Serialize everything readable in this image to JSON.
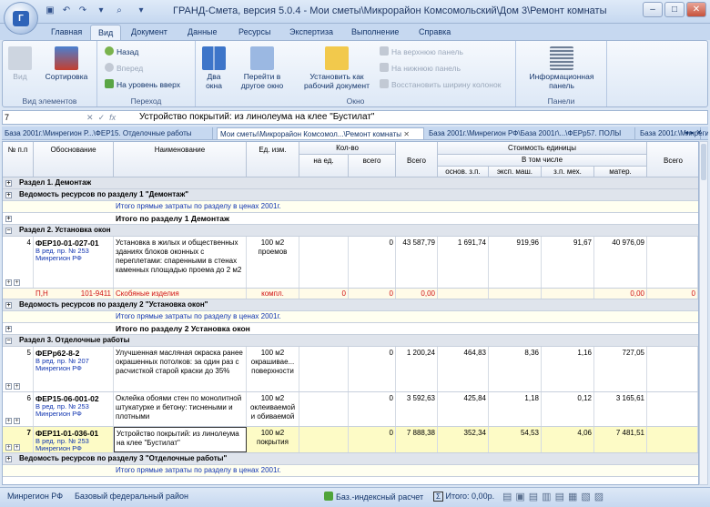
{
  "window": {
    "title": "ГРАНД-Смета, версия 5.0.4 - Мои сметы\\Микрорайон Комсомольский\\Дом 3\\Ремонт комнаты",
    "min": "–",
    "max": "□",
    "close": "✕"
  },
  "ribbon_tabs": [
    "Главная",
    "Вид",
    "Документ",
    "Данные",
    "Ресурсы",
    "Экспертиза",
    "Выполнение",
    "Справка"
  ],
  "ribbon": {
    "elements": {
      "view": "Вид",
      "sort": "Сортировка",
      "label": "Вид элементов"
    },
    "nav": {
      "back": "Назад",
      "forward": "Вперед",
      "up": "На уровень вверх",
      "label": "Переход"
    },
    "window": {
      "two": "Два окна",
      "goto": "Перейти в другое окно",
      "set": "Установить как рабочий документ",
      "top": "На верхнюю панель",
      "bottom": "На нижнюю панель",
      "restore": "Восстановить ширину колонок",
      "label": "Окно"
    },
    "panels": {
      "info": "Информационная панель",
      "label": "Панели"
    }
  },
  "formula": {
    "cell": "7",
    "value": "Устройство покрытий: из линолеума на клее \"Бустилат\"",
    "cancel": "✕",
    "ok": "✓",
    "fx": "fx"
  },
  "doc_tabs": [
    "База 2001г.\\Минрегион Р...\\ФЕР15. Отделочные работы",
    "Мои сметы\\Микрорайон Комсомол...\\Ремонт комнаты",
    "База 2001г.\\Минрегион РФ\\База 2001г\\...\\ФЕРр57. ПОЛЫ",
    "База 2001г.\\Минрегион РФ\\База 2001г\\..."
  ],
  "headers": {
    "num": "№ п.п",
    "basis": "Обоснование",
    "name": "Наименование",
    "unit": "Ед. изм.",
    "qty": "Кол-во",
    "qty_per": "на ед.",
    "qty_total": "всего",
    "total": "Всего",
    "cost": "Стоимость единицы",
    "incl": "В том числе",
    "osn": "основ. з.п.",
    "eksp": "эксп. маш.",
    "zpmeh": "з.п. мех.",
    "mater": "матер.",
    "total2": "Всего"
  },
  "rows": {
    "r1": "Раздел 1. Демонтаж",
    "r2": "Ведомость ресурсов по разделу 1 \"Демонтаж\"",
    "r3": "Итого прямые затраты по разделу в ценах 2001г.",
    "r4": "Итого по разделу 1 Демонтаж",
    "r5": "Раздел 2. Установка окон",
    "i4": {
      "n": "4",
      "code": "ФЕР10-01-027-01",
      "refs": "В ред. пр. № 253 Минрегион РФ",
      "name": "Установка в жилых и общественных зданиях блоков оконных с переплетами: спаренными в стенах каменных площадью проема до 2 м2",
      "unit": "100 м2 проемов",
      "total": "0",
      "vsego": "43 587,79",
      "osn": "1 691,74",
      "eksp": "919,96",
      "zp": "91,67",
      "mat": "40 976,09"
    },
    "ph": {
      "label": "П,Н",
      "code": "101-9411",
      "name": "Скобяные изделия",
      "unit": "компл.",
      "q1": "0",
      "q2": "0",
      "sum": "0,00",
      "mat": "0,00",
      "last": "0"
    },
    "r6": "Ведомость ресурсов по разделу 2 \"Установка окон\"",
    "r7": "Итого прямые затраты по разделу в ценах 2001г.",
    "r8": "Итого по разделу 2 Установка окон",
    "r9": "Раздел 3. Отделочные работы",
    "i5": {
      "n": "5",
      "code": "ФЕРр62-8-2",
      "refs": "В ред. пр. № 207 Минрегион РФ",
      "name": "Улучшенная масляная окраска ранее окрашенных потолков: за один раз с расчисткой старой краски до 35%",
      "unit": "100 м2 окрашивае... поверхности",
      "total": "0",
      "vsego": "1 200,24",
      "osn": "464,83",
      "eksp": "8,36",
      "zp": "1,16",
      "mat": "727,05"
    },
    "i6": {
      "n": "6",
      "code": "ФЕР15-06-001-02",
      "refs": "В ред. пр. № 253 Минрегион РФ",
      "name": "Оклейка обоями стен по монолитной штукатурке и бетону: тиснеными и плотными",
      "unit": "100 м2 оклеиваемой и обиваемой",
      "total": "0",
      "vsego": "3 592,63",
      "osn": "425,84",
      "eksp": "1,18",
      "zp": "0,12",
      "mat": "3 165,61"
    },
    "i7": {
      "n": "7",
      "code": "ФЕР11-01-036-01",
      "refs": "В ред. пр. № 253 Минрегион РФ",
      "name": "Устройство покрытий: из линолеума на клее \"Бустилат\"",
      "unit": "100 м2 покрытия",
      "total": "0",
      "vsego": "7 888,38",
      "osn": "352,34",
      "eksp": "54,53",
      "zp": "4,06",
      "mat": "7 481,51"
    },
    "r10": "Ведомость ресурсов по разделу 3 \"Отделочные работы\"",
    "r11": "Итого прямые затраты по разделу в ценах 2001г."
  },
  "status": {
    "region": "Минрегион РФ",
    "district": "Базовый федеральный район",
    "calc": "Баз.-индексный расчет",
    "total": "Итого: 0,00р."
  }
}
